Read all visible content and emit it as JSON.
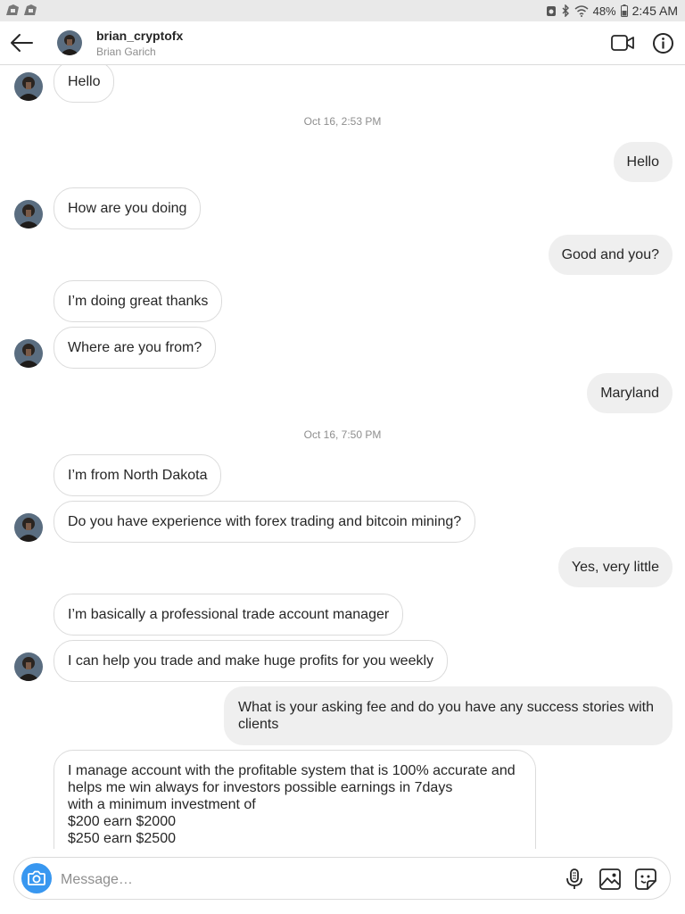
{
  "status_bar": {
    "battery_pct": "48%",
    "time": "2:45 AM"
  },
  "header": {
    "username": "brian_cryptofx",
    "full_name": "Brian Garich"
  },
  "thread": {
    "stamps": [
      "Oct 16, 2:53 PM",
      "Oct 16, 7:50 PM"
    ],
    "messages": [
      {
        "from": "them",
        "text": "Hello"
      },
      {
        "from": "me",
        "text": "Hello"
      },
      {
        "from": "them",
        "text": "How are you doing"
      },
      {
        "from": "me",
        "text": "Good and you?"
      },
      {
        "from": "them",
        "text": "I’m doing great thanks"
      },
      {
        "from": "them",
        "text": "Where are you from?"
      },
      {
        "from": "me",
        "text": "Maryland"
      },
      {
        "from": "them",
        "text": "I’m from North Dakota"
      },
      {
        "from": "them",
        "text": "Do you have experience with forex trading and bitcoin mining?"
      },
      {
        "from": "me",
        "text": "Yes, very little"
      },
      {
        "from": "them",
        "text": "I’m basically a professional trade account manager"
      },
      {
        "from": "them",
        "text": "I can help you trade and make huge profits for you weekly"
      },
      {
        "from": "me",
        "text": "What is your asking fee and do you have any success stories with\nclients"
      },
      {
        "from": "them",
        "text": "I manage account with the profitable system that is 100% accurate and\nhelps me win always for investors possible earnings in 7days\nwith a minimum investment of\n$200 earn $2000\n$250 earn $2500"
      }
    ]
  },
  "composer": {
    "placeholder": "Message…"
  },
  "colors": {
    "accent": "#3897f0",
    "outgoing_bubble": "#efefef",
    "incoming_border": "#dbdbdb",
    "timestamp": "#8e8e8e"
  },
  "icons": [
    "back-arrow-icon",
    "video-call-icon",
    "info-icon",
    "camera-icon",
    "microphone-icon",
    "gallery-icon",
    "sticker-icon"
  ]
}
